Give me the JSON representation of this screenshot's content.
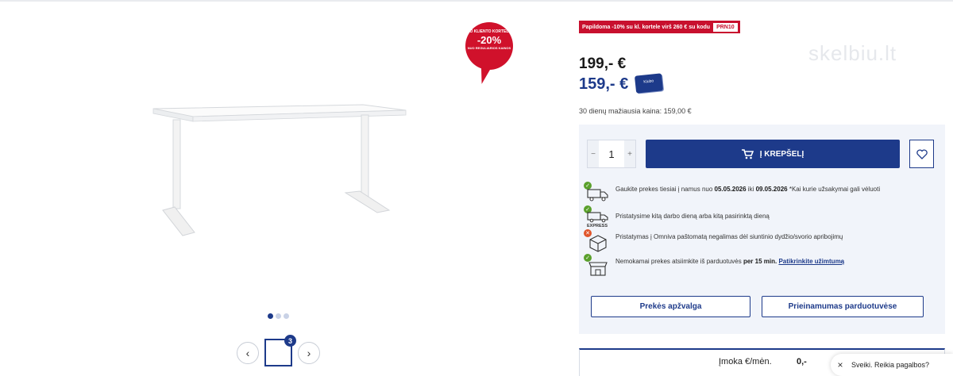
{
  "badge": {
    "line1": "SU KLIENTO KORTELE",
    "discount": "-20%",
    "line3": "NUO REGULIARIOS KAINOS"
  },
  "gallery": {
    "image_count": "3",
    "dots": 3,
    "active_dot": 0
  },
  "promo": {
    "text": "Papildoma -10% su kl. kortele virš 260 € su kodu",
    "code": "PRN10"
  },
  "watermark": "skelbiu.lt",
  "price": {
    "regular": "199,- €",
    "club": "159,- €",
    "card_label": "Klubo"
  },
  "lowest_price": "30 dienų mažiausia kaina: 159,00 €",
  "cart": {
    "qty": "1",
    "minus": "−",
    "plus": "+",
    "add_label": "Į KREPŠELĮ"
  },
  "delivery": [
    {
      "status": "ok",
      "icon": "truck-icon",
      "pre": "Gaukite prekes tiesiai į namus nuo ",
      "d1": "05.05.2026",
      "mid": " iki ",
      "d2": "09.05.2026",
      "post": " *Kai kurie užsakymai gali vėluoti"
    },
    {
      "status": "ok",
      "icon": "express-truck-icon",
      "text": "Pristatysime kitą darbo dieną arba kitą pasirinktą dieną",
      "tag": "EXPRESS"
    },
    {
      "status": "no",
      "icon": "parcel-box-icon",
      "text": "Pristatymas į Omniva paštomatą negalimas dėl siuntinio dydžio/svorio apribojimų"
    },
    {
      "status": "ok",
      "icon": "store-icon",
      "pre": "Nemokamai prekes atsiimkite iš parduotuvės ",
      "bold": "per 15 min.",
      "link": "Patikrinkite užimtumą"
    }
  ],
  "buttons": {
    "overview": "Prekės apžvalga",
    "availability": "Prieinamumas parduotuvėse"
  },
  "installment": {
    "label": "Įmoka €/mėn.",
    "amount": "0,-"
  },
  "chat": {
    "close": "×",
    "text": "Sveiki. Reikia pagalbos?"
  },
  "colors": {
    "brand": "#1d3a8a",
    "promo": "#c8102e",
    "ok": "#5aa02c",
    "error": "#e0552b"
  }
}
